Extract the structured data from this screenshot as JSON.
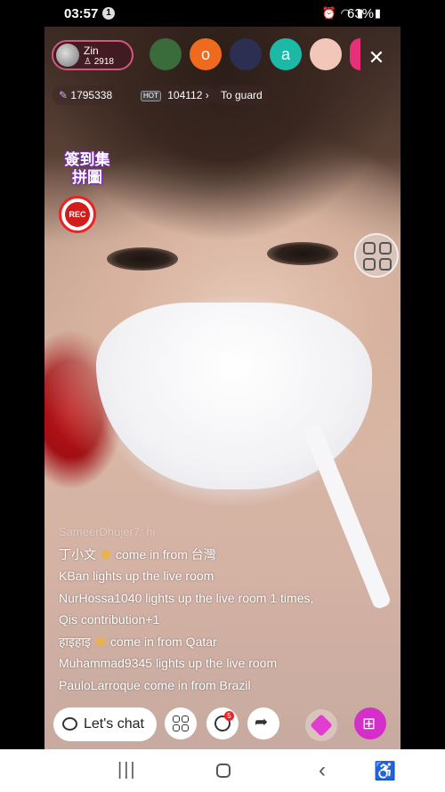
{
  "status_bar": {
    "time": "03:57",
    "notification_count": "1",
    "battery": "63%",
    "icons": [
      "alarm-icon",
      "wifi-icon",
      "signal-icon",
      "battery-icon"
    ]
  },
  "host": {
    "name": "Zin",
    "fans": "2918"
  },
  "viewers": [
    {
      "letter": "",
      "color": "#3a6b3a"
    },
    {
      "letter": "o",
      "color": "#f06a1e"
    },
    {
      "letter": "",
      "color": "#2c2e52"
    },
    {
      "letter": "a",
      "color": "#1bb9a6"
    },
    {
      "letter": "",
      "color": "#f2c6b8"
    },
    {
      "letter": "",
      "color": "#e8307a"
    }
  ],
  "stats": {
    "points": "1795338",
    "hot_tag": "HOT",
    "hot_value": "104112",
    "guard_label": "To guard"
  },
  "promo_text": "簽到集拼圖",
  "rec_label": "REC",
  "chat_messages": [
    {
      "user": "SameerDhujer7",
      "text": ": hi",
      "faded": true,
      "coin": false
    },
    {
      "user": "丁小文",
      "text": "come in from 台灣",
      "faded": false,
      "coin": true
    },
    {
      "user": "KBan",
      "text": "lights up the live room",
      "faded": false,
      "coin": false
    },
    {
      "user": "NurHossa1040",
      "text": "lights up the live room 1 times,",
      "faded": false,
      "coin": false
    },
    {
      "user": "",
      "text": "Qis contribution+1",
      "faded": false,
      "coin": false
    },
    {
      "user": "हाइहाइ",
      "text": "come in from Qatar",
      "faded": false,
      "coin": true
    },
    {
      "user": "Muhammad9345",
      "text": "lights up the live room",
      "faded": false,
      "coin": false
    },
    {
      "user": "PauloLarroque",
      "text": "come in from Brazil",
      "faded": false,
      "coin": false
    }
  ],
  "controls": {
    "chat_label": "Let's chat",
    "badge_count": "5"
  },
  "colors": {
    "accent_pink": "#d430c9",
    "rec_red": "#d21d1d",
    "host_border": "#d0597c"
  }
}
